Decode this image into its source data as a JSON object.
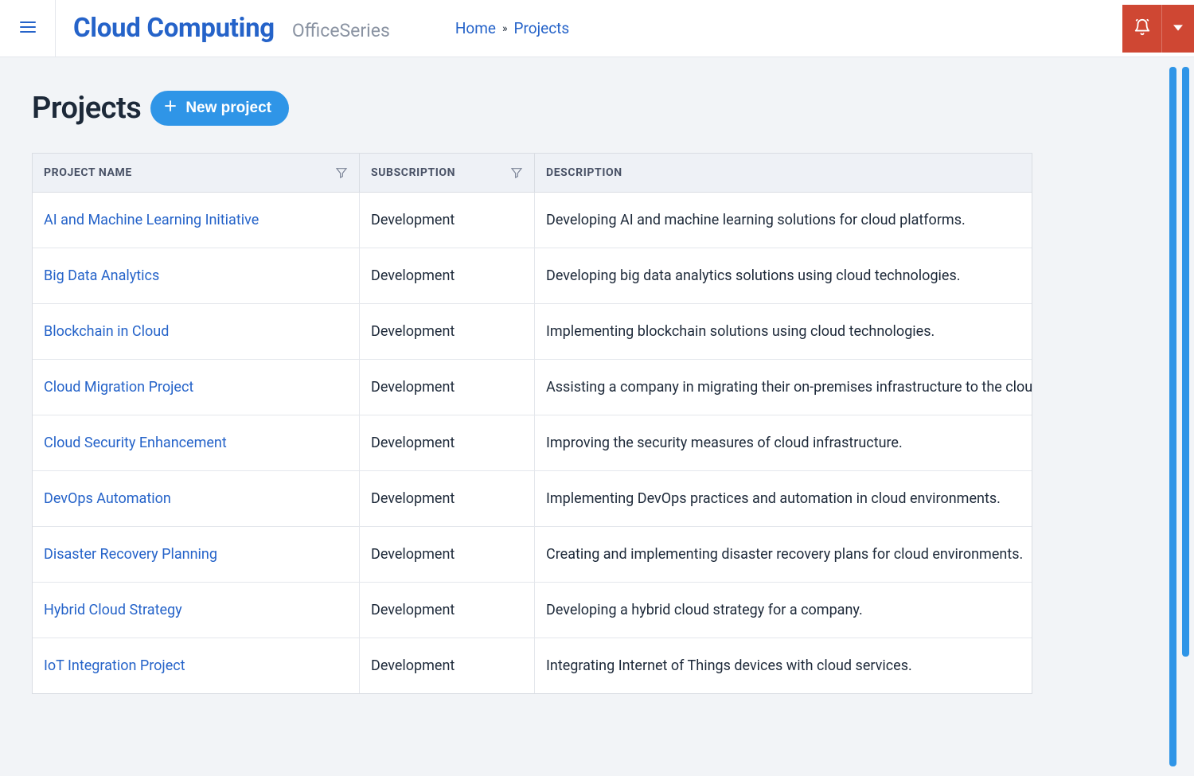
{
  "header": {
    "brand_title": "Cloud Computing",
    "brand_subtitle": "OfficeSeries"
  },
  "breadcrumb": {
    "home_label": "Home",
    "current_label": "Projects"
  },
  "page": {
    "title": "Projects",
    "new_button_label": "New project"
  },
  "table": {
    "columns": {
      "project_name": "Project Name",
      "subscription": "Subscription",
      "description": "Description"
    },
    "rows": [
      {
        "name": "AI and Machine Learning Initiative",
        "subscription": "Development",
        "description": "Developing AI and machine learning solutions for cloud platforms."
      },
      {
        "name": "Big Data Analytics",
        "subscription": "Development",
        "description": "Developing big data analytics solutions using cloud technologies."
      },
      {
        "name": "Blockchain in Cloud",
        "subscription": "Development",
        "description": "Implementing blockchain solutions using cloud technologies."
      },
      {
        "name": "Cloud Migration Project",
        "subscription": "Development",
        "description": "Assisting a company in migrating their on-premises infrastructure to the cloud."
      },
      {
        "name": "Cloud Security Enhancement",
        "subscription": "Development",
        "description": "Improving the security measures of cloud infrastructure."
      },
      {
        "name": "DevOps Automation",
        "subscription": "Development",
        "description": "Implementing DevOps practices and automation in cloud environments."
      },
      {
        "name": "Disaster Recovery Planning",
        "subscription": "Development",
        "description": "Creating and implementing disaster recovery plans for cloud environments."
      },
      {
        "name": "Hybrid Cloud Strategy",
        "subscription": "Development",
        "description": "Developing a hybrid cloud strategy for a company."
      },
      {
        "name": "IoT Integration Project",
        "subscription": "Development",
        "description": "Integrating Internet of Things devices with cloud services."
      }
    ]
  }
}
